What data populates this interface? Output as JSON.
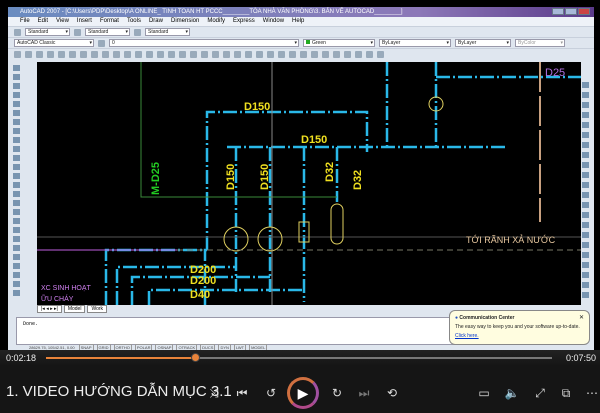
{
  "autocad": {
    "title": "AutoCAD 2007 - [C:\\Users\\PDP\\Desktop\\A ONLINE_ TINH TOAN HT PCCC________TÒA NHÀ VĂN PHÒNG\\3. BẢN VẼ AUTOCAD________]",
    "menu": [
      "File",
      "Edit",
      "View",
      "Insert",
      "Format",
      "Tools",
      "Draw",
      "Dimension",
      "Modify",
      "Express",
      "Window",
      "Help"
    ],
    "toolbar1": {
      "text_style": "Standard",
      "dim_style": "Standard",
      "table_style": "Standard"
    },
    "toolbar2": {
      "workspace": "AutoCAD Classic",
      "layer": "0",
      "color": "Green",
      "color_swatch": "#22aa22",
      "linetype": "ByLayer",
      "lineweight": "ByLayer",
      "plotstyle": "ByColor"
    },
    "drawing": {
      "labels": {
        "d150a": "D150",
        "d150b": "D150",
        "d150v1": "D150",
        "d150v2": "D150",
        "d32a": "D32",
        "d32b": "D32",
        "md25": "M-D25",
        "d25": "D25",
        "d200a": "D200",
        "d200b": "D200",
        "d40": "D40",
        "drain": "TỚI RÃNH XẢ NƯỚC",
        "sinhhoat": "XC SINH HOẠT",
        "chay": "ỮU CHÁY"
      },
      "colors": {
        "pipe": "#2ab8e8",
        "label": "#f0e020",
        "green": "#22cc22",
        "magenta": "#c060e0"
      }
    },
    "tabs": [
      "Model",
      "Work"
    ],
    "command": "Done.",
    "status": {
      "coords": "28629.75, 10542.51, 0.00",
      "toggles": [
        "SNAP",
        "GRID",
        "ORTHO",
        "POLAR",
        "OSNAP",
        "OTRACK",
        "DUCS",
        "DYN",
        "LWT",
        "MODEL"
      ]
    },
    "balloon": {
      "title": "Communication Center",
      "body": "The easy way to keep you and your software up-to-date.",
      "link": "Click here."
    }
  },
  "player": {
    "elapsed": "0:02:18",
    "total": "0:07:50",
    "progress": 0.294,
    "title": "1. VIDEO HƯỚNG DẪN MỤC 3.1",
    "accent": "#e8833a",
    "buttons": {
      "shuffle": "⤨",
      "prev": "⏮",
      "back10": "↺",
      "play": "▶",
      "fwd30": "↻",
      "next": "⏭",
      "repeat": "⟲",
      "captions": "▭",
      "volume": "🔈",
      "fullscreen": "⤢",
      "miniplayer": "⧉",
      "more": "⋯"
    }
  }
}
